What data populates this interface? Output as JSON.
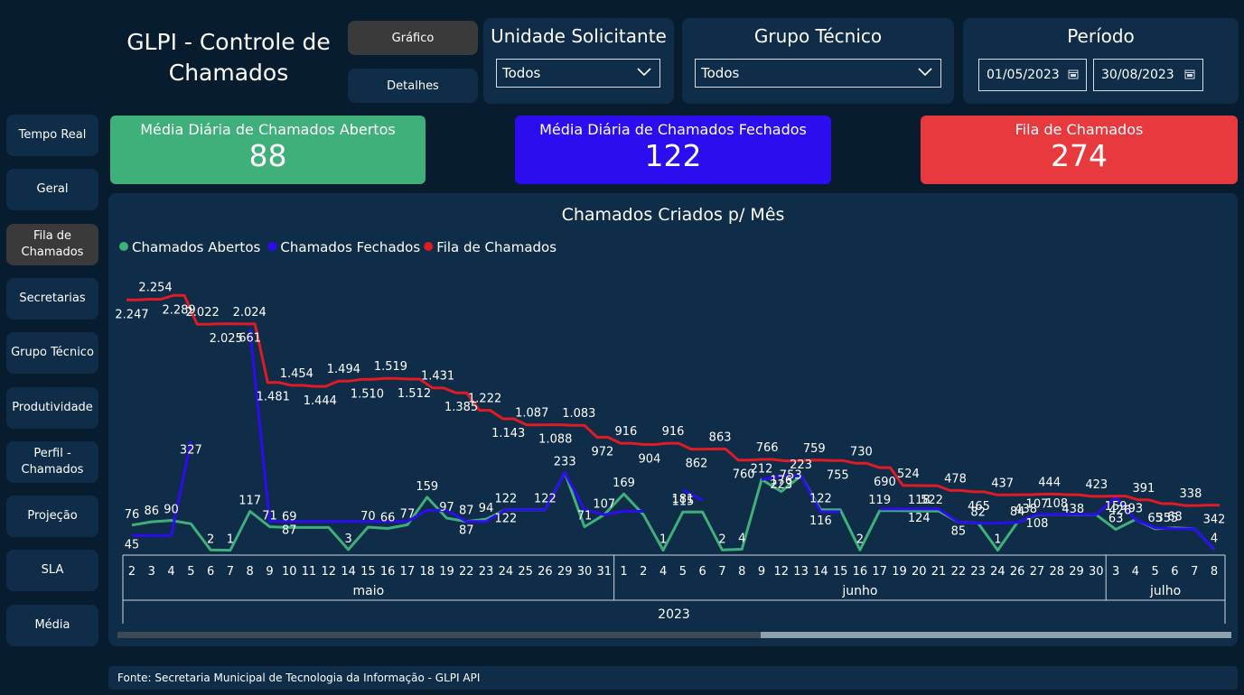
{
  "header": {
    "title": "GLPI - Controle de Chamados",
    "view_buttons": [
      "Gráfico",
      "Detalhes"
    ]
  },
  "filters": {
    "unidade": {
      "label": "Unidade Solicitante",
      "value": "Todos"
    },
    "grupo": {
      "label": "Grupo Técnico",
      "value": "Todos"
    },
    "periodo": {
      "label": "Período",
      "start": "01/05/2023",
      "end": "30/08/2023"
    }
  },
  "sidebar": {
    "items": [
      "Tempo Real",
      "Geral",
      "Fila de Chamados",
      "Secretarias",
      "Grupo Técnico",
      "Produtividade",
      "Perfil - Chamados",
      "Projeção",
      "SLA",
      "Média"
    ],
    "active_index": 2
  },
  "cards": [
    {
      "label": "Média Diária de Chamados Abertos",
      "value": "88",
      "color": "#3fb07a"
    },
    {
      "label": "Média Diária de Chamados Fechados",
      "value": "122",
      "color": "#2b0df0"
    },
    {
      "label": "Fila de Chamados",
      "value": "274",
      "color": "#e8393f"
    }
  ],
  "chart_data": {
    "type": "line",
    "title": "Chamados Criados p/ Mês",
    "legend_position": "top-left",
    "categories": [
      "2",
      "3",
      "4",
      "5",
      "6",
      "7",
      "8",
      "9",
      "10",
      "11",
      "12",
      "14",
      "15",
      "16",
      "17",
      "18",
      "19",
      "22",
      "23",
      "24",
      "25",
      "26",
      "29",
      "30",
      "31",
      "1",
      "2",
      "4",
      "5",
      "6",
      "7",
      "8",
      "9",
      "12",
      "13",
      "14",
      "15",
      "16",
      "17",
      "19",
      "20",
      "21",
      "22",
      "23",
      "24",
      "26",
      "27",
      "28",
      "29",
      "30",
      "3",
      "4",
      "5",
      "6",
      "7",
      "8"
    ],
    "month_groups": [
      {
        "label": "maio",
        "count": 25
      },
      {
        "label": "junho",
        "count": 25
      },
      {
        "label": "julho",
        "count": 6
      }
    ],
    "year_label": "2023",
    "series": [
      {
        "name": "Chamados Abertos",
        "color": "#3fb07a",
        "values": [
          76,
          86,
          90,
          80,
          2,
          1,
          117,
          71,
          69,
          69,
          69,
          3,
          70,
          66,
          77,
          159,
          97,
          87,
          94,
          122,
          122,
          122,
          233,
          71,
          107,
          169,
          107,
          1,
          115,
          115,
          2,
          4,
          212,
          176,
          223,
          122,
          122,
          2,
          119,
          119,
          118,
          118,
          85,
          82,
          1,
          84,
          107,
          108,
          107,
          107,
          63,
          93,
          65,
          68,
          65,
          4
        ],
        "labels": [
          "76",
          "86",
          "90",
          "",
          "2",
          "1",
          "117",
          "71",
          "69",
          "",
          "",
          "3",
          "70",
          "66",
          "77",
          "159",
          "97",
          "87",
          "94",
          "122",
          "",
          "122",
          "233",
          "71",
          "107",
          "169",
          "",
          "1",
          "115",
          "",
          "2",
          "4",
          "212",
          "176",
          "223",
          "122",
          "",
          "2",
          "119",
          "",
          "118",
          "",
          "",
          "82",
          "1",
          "84",
          "107",
          "108",
          "",
          "",
          "63",
          "93",
          "65",
          "68",
          "",
          "4"
        ]
      },
      {
        "name": "Chamados Fechados",
        "color": "#2b0df0",
        "values": [
          45,
          45,
          45,
          327,
          null,
          null,
          661,
          87,
          87,
          87,
          87,
          87,
          87,
          87,
          87,
          120,
          120,
          87,
          87,
          122,
          122,
          122,
          233,
          122,
          107,
          117,
          117,
          null,
          181,
          150,
          null,
          null,
          212,
          223,
          223,
          116,
          116,
          null,
          124,
          124,
          124,
          124,
          85,
          82,
          82,
          84,
          108,
          108,
          108,
          107,
          159,
          93,
          68,
          65,
          65,
          4
        ],
        "labels": [
          "45",
          "",
          "",
          "327",
          "",
          "",
          "661",
          "",
          "87",
          "",
          "",
          "",
          "",
          "",
          "",
          "",
          "",
          "87",
          "",
          "122",
          "",
          "",
          "",
          "",
          "",
          "",
          "",
          "",
          "181",
          "",
          "",
          "",
          "",
          "223",
          "",
          "116",
          "",
          "",
          "",
          "",
          "124",
          "",
          "85",
          "",
          "",
          "",
          "108",
          "",
          "",
          "",
          "159",
          "",
          "",
          "",
          "",
          ""
        ]
      },
      {
        "name": "Fila de Chamados",
        "color": "#e01b24",
        "values": [
          2247,
          2254,
          2289,
          2022,
          2025,
          2024,
          1481,
          1454,
          1444,
          1494,
          1510,
          1519,
          1512,
          1431,
          1385,
          1222,
          1143,
          1087,
          1088,
          1083,
          972,
          916,
          904,
          916,
          862,
          863,
          760,
          766,
          753,
          759,
          755,
          730,
          690,
          524,
          522,
          478,
          465,
          437,
          438,
          444,
          438,
          423,
          426,
          391,
          355,
          338,
          342
        ],
        "labels": [
          "2.247",
          "2.254",
          "2.289",
          "2.022",
          "2.025",
          "2.024",
          "1.481",
          "1.454",
          "1.444",
          "1.494",
          "1.510",
          "1.519",
          "1.512",
          "1.431",
          "1.385",
          "1.222",
          "1.143",
          "1.087",
          "1.088",
          "1.083",
          "972",
          "916",
          "904",
          "916",
          "862",
          "863",
          "760",
          "766",
          "753",
          "759",
          "755",
          "730",
          "690",
          "524",
          "522",
          "478",
          "465",
          "437",
          "438",
          "444",
          "438",
          "423",
          "426",
          "391",
          "355",
          "338",
          "342"
        ]
      }
    ]
  },
  "footer": {
    "source": "Fonte: Secretaria Municipal de Tecnologia da Informação - GLPI API"
  }
}
